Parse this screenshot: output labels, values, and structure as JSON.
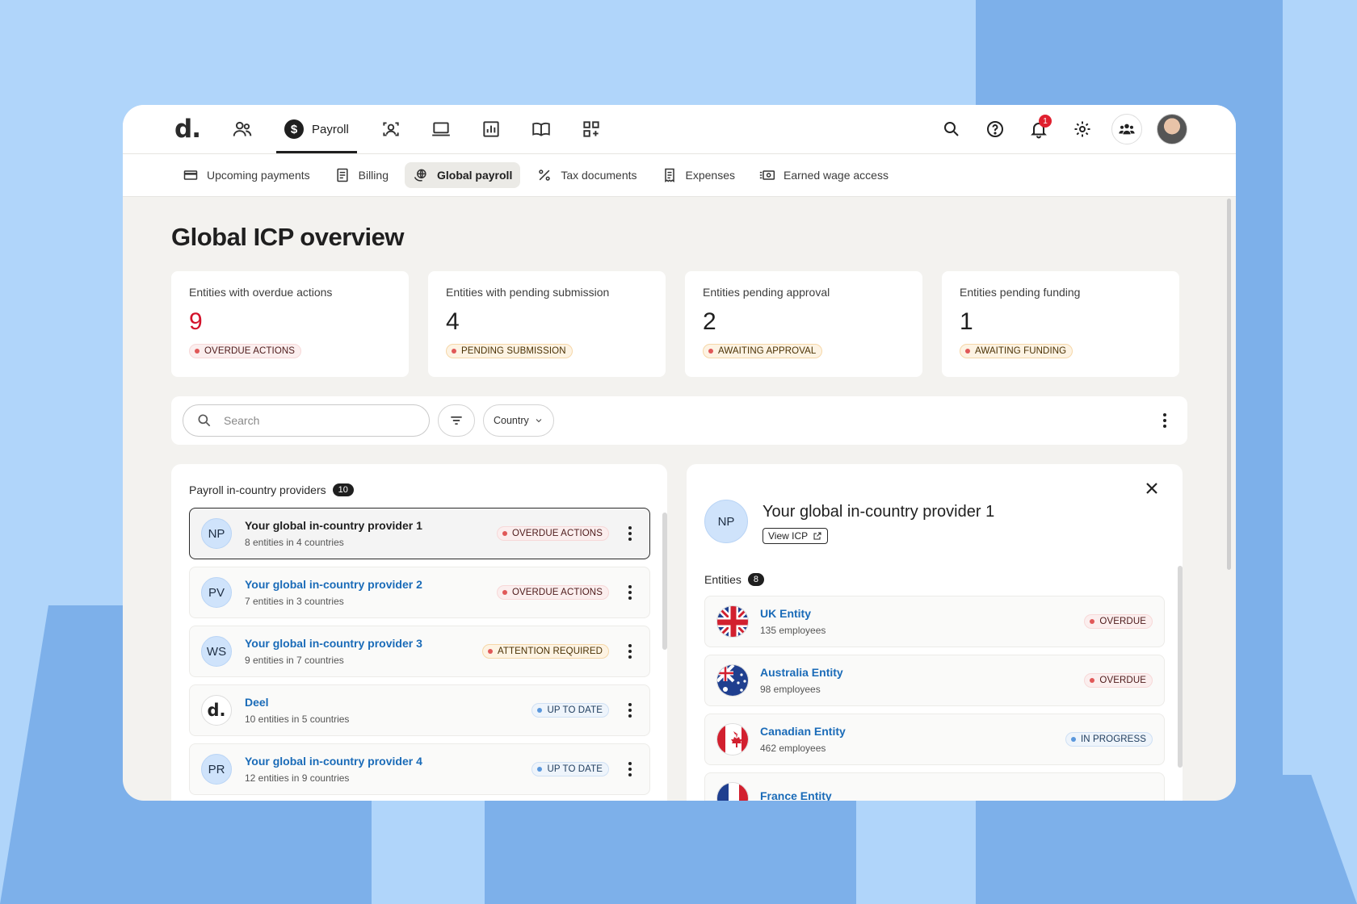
{
  "topbar": {
    "logo": "d.",
    "active_tab_label": "Payroll",
    "notification_count": "1",
    "nav_icons": [
      "people-icon",
      "payroll-icon",
      "user-scan-icon",
      "laptop-icon",
      "analytics-icon",
      "book-icon",
      "apps-grid-icon"
    ]
  },
  "subnav": {
    "items": [
      {
        "label": "Upcoming payments",
        "icon": "card-icon"
      },
      {
        "label": "Billing",
        "icon": "invoice-icon"
      },
      {
        "label": "Global payroll",
        "icon": "globe-hand-icon",
        "active": true
      },
      {
        "label": "Tax documents",
        "icon": "percent-icon"
      },
      {
        "label": "Expenses",
        "icon": "receipt-icon"
      },
      {
        "label": "Earned wage access",
        "icon": "cash-icon"
      }
    ]
  },
  "page": {
    "title": "Global ICP overview"
  },
  "stats": [
    {
      "label": "Entities with overdue actions",
      "value": "9",
      "badge": "OVERDUE ACTIONS",
      "tone": "red"
    },
    {
      "label": "Entities with pending submission",
      "value": "4",
      "badge": "PENDING SUBMISSION",
      "tone": "orange"
    },
    {
      "label": "Entities pending approval",
      "value": "2",
      "badge": "AWAITING APPROVAL",
      "tone": "orange"
    },
    {
      "label": "Entities pending funding",
      "value": "1",
      "badge": "AWAITING FUNDING",
      "tone": "orange"
    }
  ],
  "filters": {
    "search_placeholder": "Search",
    "country_label": "Country"
  },
  "providers": {
    "title": "Payroll in-country providers",
    "count": "10",
    "rows": [
      {
        "initials": "NP",
        "name": "Your global in-country provider 1",
        "sub": "8 entities in 4 countries",
        "status": "OVERDUE ACTIONS",
        "tone": "red",
        "selected": true
      },
      {
        "initials": "PV",
        "name": "Your global in-country provider 2",
        "sub": "7 entities in 3 countries",
        "status": "OVERDUE ACTIONS",
        "tone": "red"
      },
      {
        "initials": "WS",
        "name": "Your global in-country provider 3",
        "sub": "9 entities in 7 countries",
        "status": "ATTENTION REQUIRED",
        "tone": "orange"
      },
      {
        "initials": "d.",
        "name": "Deel",
        "sub": "10 entities in 5 countries",
        "status": "UP TO DATE",
        "tone": "blue",
        "deel": true
      },
      {
        "initials": "PR",
        "name": "Your global in-country provider 4",
        "sub": "12 entities in 9 countries",
        "status": "UP TO DATE",
        "tone": "blue"
      }
    ]
  },
  "detail": {
    "initials": "NP",
    "title": "Your global in-country provider 1",
    "view_label": "View ICP",
    "entities_label": "Entities",
    "entities_count": "8",
    "entities": [
      {
        "name": "UK Entity",
        "sub": "135 employees",
        "status": "OVERDUE",
        "tone": "red",
        "flag": "uk-flag-icon"
      },
      {
        "name": "Australia Entity",
        "sub": "98 employees",
        "status": "OVERDUE",
        "tone": "red",
        "flag": "australia-flag-icon"
      },
      {
        "name": "Canadian Entity",
        "sub": "462 employees",
        "status": "IN PROGRESS",
        "tone": "blue",
        "flag": "canada-flag-icon"
      },
      {
        "name": "France Entity",
        "sub": "",
        "status": "",
        "tone": "blue",
        "flag": "france-flag-icon"
      }
    ]
  }
}
